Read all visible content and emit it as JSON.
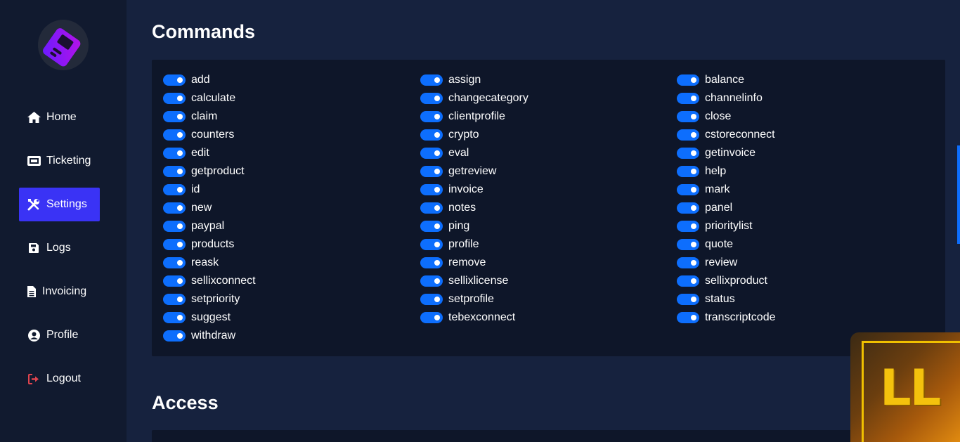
{
  "sidebar": {
    "items": [
      {
        "label": "Home",
        "icon": "home-icon"
      },
      {
        "label": "Ticketing",
        "icon": "ticket-icon"
      },
      {
        "label": "Settings",
        "icon": "tools-icon",
        "active": true
      },
      {
        "label": "Logs",
        "icon": "save-icon"
      },
      {
        "label": "Invoicing",
        "icon": "file-icon"
      },
      {
        "label": "Profile",
        "icon": "user-circle-icon"
      },
      {
        "label": "Logout",
        "icon": "logout-icon"
      }
    ]
  },
  "commands": {
    "title": "Commands",
    "col1": [
      "add",
      "calculate",
      "claim",
      "counters",
      "edit",
      "getproduct",
      "id",
      "new",
      "paypal",
      "products",
      "reask",
      "sellixconnect",
      "setpriority",
      "suggest",
      "withdraw"
    ],
    "col2": [
      "assign",
      "changecategory",
      "clientprofile",
      "crypto",
      "eval",
      "getreview",
      "invoice",
      "notes",
      "ping",
      "profile",
      "remove",
      "sellixlicense",
      "setprofile",
      "tebexconnect"
    ],
    "col3": [
      "balance",
      "channelinfo",
      "close",
      "cstoreconnect",
      "getinvoice",
      "help",
      "mark",
      "panel",
      "prioritylist",
      "quote",
      "review",
      "sellixproduct",
      "status",
      "transcriptcode"
    ]
  },
  "access": {
    "title": "Access"
  },
  "badge": {
    "text": "LL"
  },
  "colors": {
    "accent": "#3a33f5",
    "toggle": "#0d6efd",
    "logout_icon": "#e0444e"
  }
}
